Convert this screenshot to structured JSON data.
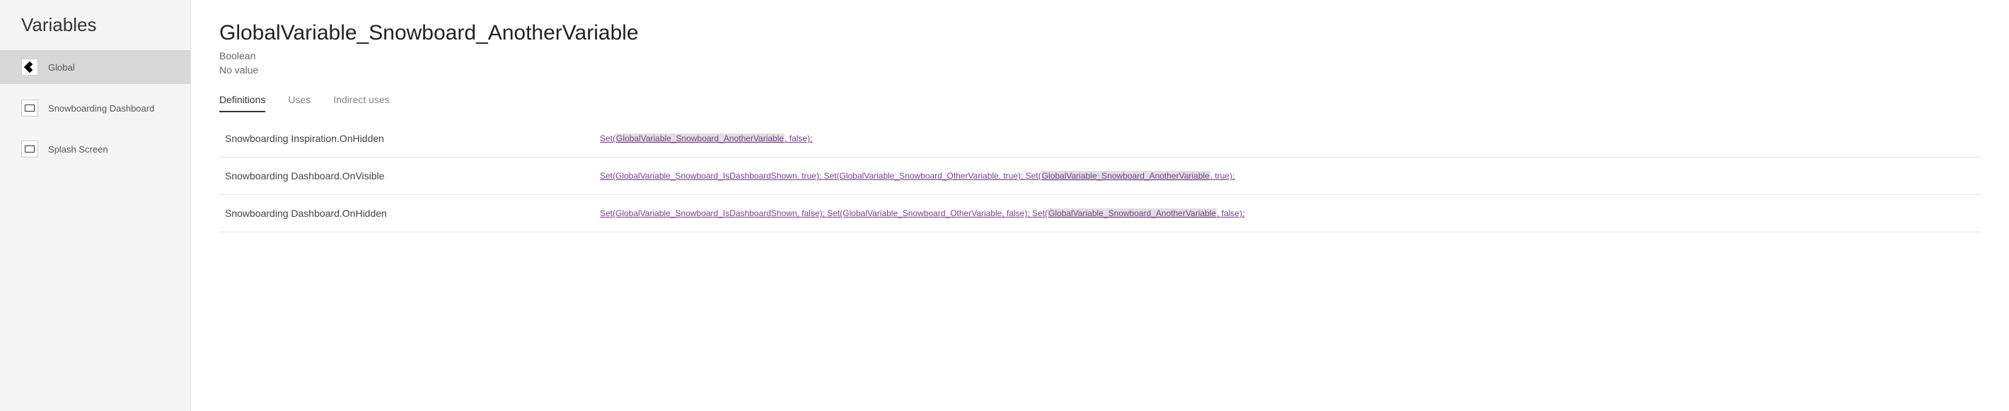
{
  "sidebar": {
    "title": "Variables",
    "items": [
      {
        "label": "Global",
        "icon": "global",
        "active": true
      },
      {
        "label": "Snowboarding Dashboard",
        "icon": "screen",
        "active": false
      },
      {
        "label": "Splash Screen",
        "icon": "screen",
        "active": false
      }
    ]
  },
  "variable": {
    "name": "GlobalVariable_Snowboard_AnotherVariable",
    "type": "Boolean",
    "value": "No value"
  },
  "tabs": [
    {
      "label": "Definitions",
      "active": true
    },
    {
      "label": "Uses",
      "active": false
    },
    {
      "label": "Indirect uses",
      "active": false
    }
  ],
  "definitions": [
    {
      "location": "Snowboarding Inspiration.OnHidden",
      "formula_parts": [
        {
          "text": "Set(",
          "hl": false
        },
        {
          "text": "GlobalVariable_Snowboard_AnotherVariable",
          "hl": true
        },
        {
          "text": ", false);",
          "hl": false
        }
      ]
    },
    {
      "location": "Snowboarding Dashboard.OnVisible",
      "formula_parts": [
        {
          "text": "Set(GlobalVariable_Snowboard_IsDashboardShown, true);  Set(GlobalVariable_Snowboard_OtherVariable, true);  Set(",
          "hl": false
        },
        {
          "text": "GlobalVariable_Snowboard_AnotherVariable",
          "hl": true
        },
        {
          "text": ", true);",
          "hl": false
        }
      ]
    },
    {
      "location": "Snowboarding Dashboard.OnHidden",
      "formula_parts": [
        {
          "text": "Set(GlobalVariable_Snowboard_IsDashboardShown, false);  Set(GlobalVariable_Snowboard_OtherVariable, false);  Set(",
          "hl": false
        },
        {
          "text": "GlobalVariable_Snowboard_AnotherVariable",
          "hl": true
        },
        {
          "text": ", false);",
          "hl": false
        }
      ]
    }
  ]
}
